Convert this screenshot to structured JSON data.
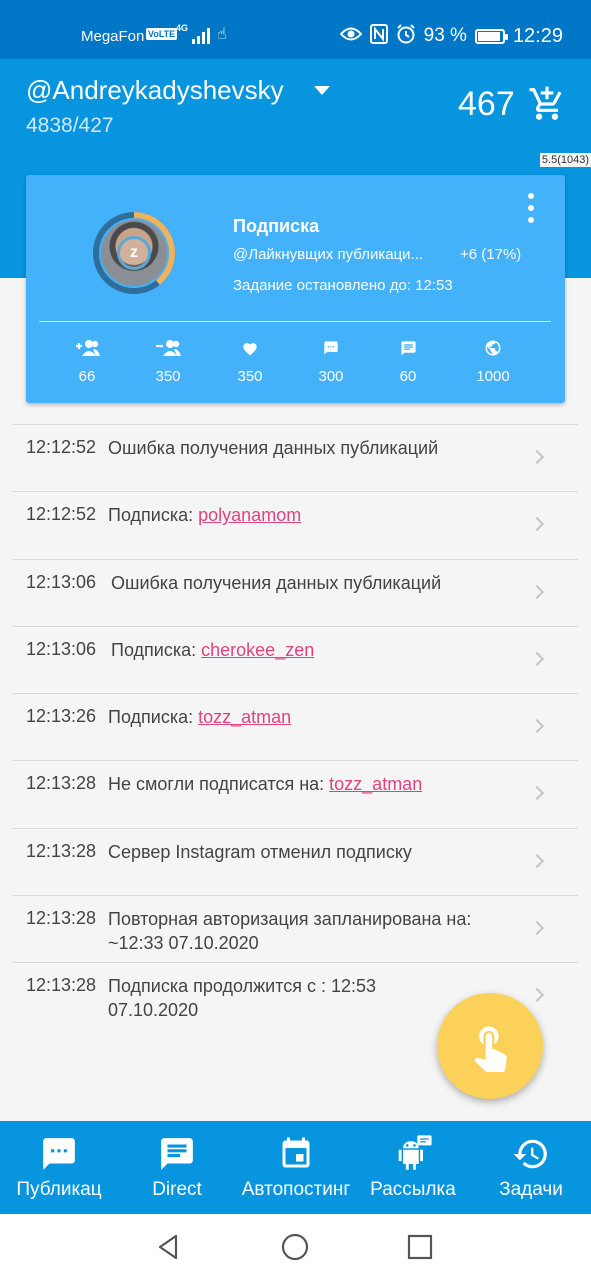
{
  "status_bar": {
    "carrier": "MegaFon",
    "volte": "VoLTE",
    "network": "4G",
    "battery_percent": "93 %",
    "battery_level": 0.93,
    "time": "12:29",
    "icons": [
      "eye-icon",
      "nfc-icon",
      "alarm-icon",
      "battery-icon"
    ]
  },
  "header": {
    "account": "@Andreykadyshevsky",
    "stats": "4838/427",
    "balance": "467",
    "version": "5.5(1043)"
  },
  "task_card": {
    "title": "Подписка",
    "target": "@Лайкнувщих публикаци...",
    "progress": "+6 (17%)",
    "stopped_until": "Задание остановлено до: 12:53",
    "stats": [
      {
        "icon": "follow-icon",
        "value": "66"
      },
      {
        "icon": "unfollow-icon",
        "value": "350"
      },
      {
        "icon": "like-icon",
        "value": "350"
      },
      {
        "icon": "comment-icon",
        "value": "300"
      },
      {
        "icon": "message-icon",
        "value": "60"
      },
      {
        "icon": "globe-icon",
        "value": "1000"
      }
    ]
  },
  "log": [
    {
      "time": "12:12:52",
      "text": "Ошибка получения данных публикаций",
      "link": ""
    },
    {
      "time": "12:12:52",
      "text": "Подписка: ",
      "link": "polyanamom"
    },
    {
      "time": "12:13:06",
      "text": "Ошибка получения данных публикаций",
      "link": ""
    },
    {
      "time": "12:13:06",
      "text": "Подписка: ",
      "link": "cherokee_zen"
    },
    {
      "time": "12:13:26",
      "text": "Подписка: ",
      "link": "tozz_atman"
    },
    {
      "time": "12:13:28",
      "text": "Не смогли подписатся на: ",
      "link": "tozz_atman"
    },
    {
      "time": "12:13:28",
      "text": "Сервер Instagram отменил подписку",
      "link": ""
    },
    {
      "time": "12:13:28",
      "text": "Повторная авторизация запланирована на: ~12:33 07.10.2020",
      "link": ""
    },
    {
      "time": "12:13:28",
      "text": "Подписка продолжится с : 12:53 07.10.2020",
      "link": ""
    }
  ],
  "bottom_nav": [
    {
      "label": "Публикац",
      "icon": "chat-dots-icon"
    },
    {
      "label": "Direct",
      "icon": "message-lines-icon"
    },
    {
      "label": "Автопостинг",
      "icon": "calendar-icon"
    },
    {
      "label": "Рассылка",
      "icon": "android-icon"
    },
    {
      "label": "Задачи",
      "icon": "history-icon"
    }
  ],
  "colors": {
    "status_bar": "#0077c6",
    "primary": "#0795e0",
    "card": "#43b2fa",
    "link": "#e0437f",
    "fab": "#fbd15a"
  }
}
